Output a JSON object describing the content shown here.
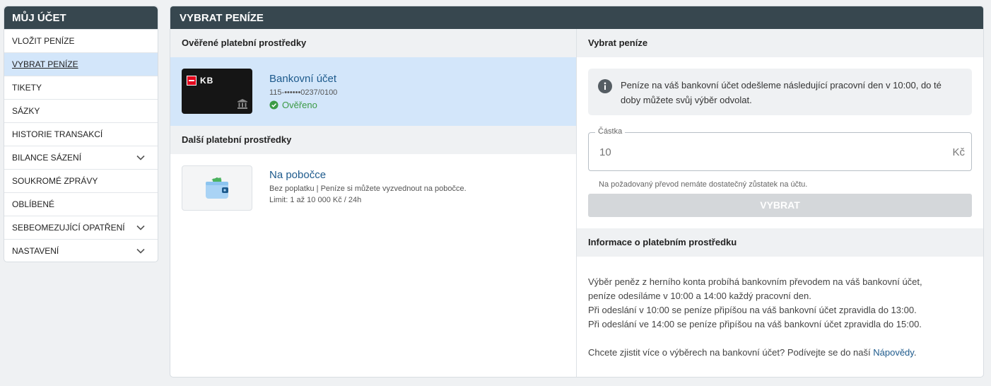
{
  "sidebar": {
    "title": "MŮJ ÚČET",
    "items": [
      {
        "label": "VLOŽIT PENÍZE"
      },
      {
        "label": "VYBRAT PENÍZE"
      },
      {
        "label": "TIKETY"
      },
      {
        "label": "SÁZKY"
      },
      {
        "label": "HISTORIE TRANSAKCÍ"
      },
      {
        "label": "BILANCE SÁZENÍ"
      },
      {
        "label": "SOUKROMÉ ZPRÁVY"
      },
      {
        "label": "OBLÍBENÉ"
      },
      {
        "label": "SEBEOMEZUJÍCÍ OPATŘENÍ"
      },
      {
        "label": "NASTAVENÍ"
      }
    ],
    "active_item": "VYBRAT PENÍZE",
    "expandable_items": [
      "BILANCE SÁZENÍ",
      "SEBEOMEZUJÍCÍ OPATŘENÍ",
      "NASTAVENÍ"
    ]
  },
  "main": {
    "title": "VYBRAT PENÍZE",
    "verified_methods": {
      "title": "Ověřené platební prostředky",
      "bank": {
        "logo_text": "KB",
        "name": "Bankovní účet",
        "account": "115-••••••0237/0100",
        "status": "Ověřeno"
      }
    },
    "other_methods": {
      "title": "Další platební prostředky",
      "branch": {
        "name": "Na pobočce",
        "description": "Bez poplatku | Peníze si můžete vyzvednout na pobočce.",
        "limit": "Limit: 1 až 10 000 Kč / 24h"
      }
    },
    "withdraw": {
      "title": "Vybrat peníze",
      "notice": "Peníze na váš bankovní účet odešleme následující pracovní den v 10:00, do té doby můžete svůj výběr odvolat.",
      "amount_label": "Částka",
      "amount_value": "10",
      "currency": "Kč",
      "hint": "Na požadovaný převod nemáte dostatečný zůstatek na účtu.",
      "button_label": "VYBRAT"
    },
    "method_info": {
      "title": "Informace o platebním prostředku",
      "line1": "Výběr peněz z herního konta probíhá bankovním převodem na váš bankovní účet,",
      "line2": "peníze odesíláme v 10:00 a 14:00 každý pracovní den.",
      "line3": "Při odeslání v 10:00 se peníze připíšou na váš bankovní účet zpravidla do 13:00.",
      "line4": "Při odeslání ve 14:00 se peníze připíšou na váš bankovní účet zpravidla do 15:00.",
      "help_prefix": "Chcete zjistit více o výběrech na bankovní účet? Podívejte se do naší ",
      "help_link": "Nápovědy",
      "help_suffix": "."
    }
  },
  "colors": {
    "header_bg": "#37474f",
    "active_bg": "#d3e6fa",
    "link": "#1d5a8c",
    "verified": "#3b9a45",
    "kb_red": "#e3001b"
  }
}
